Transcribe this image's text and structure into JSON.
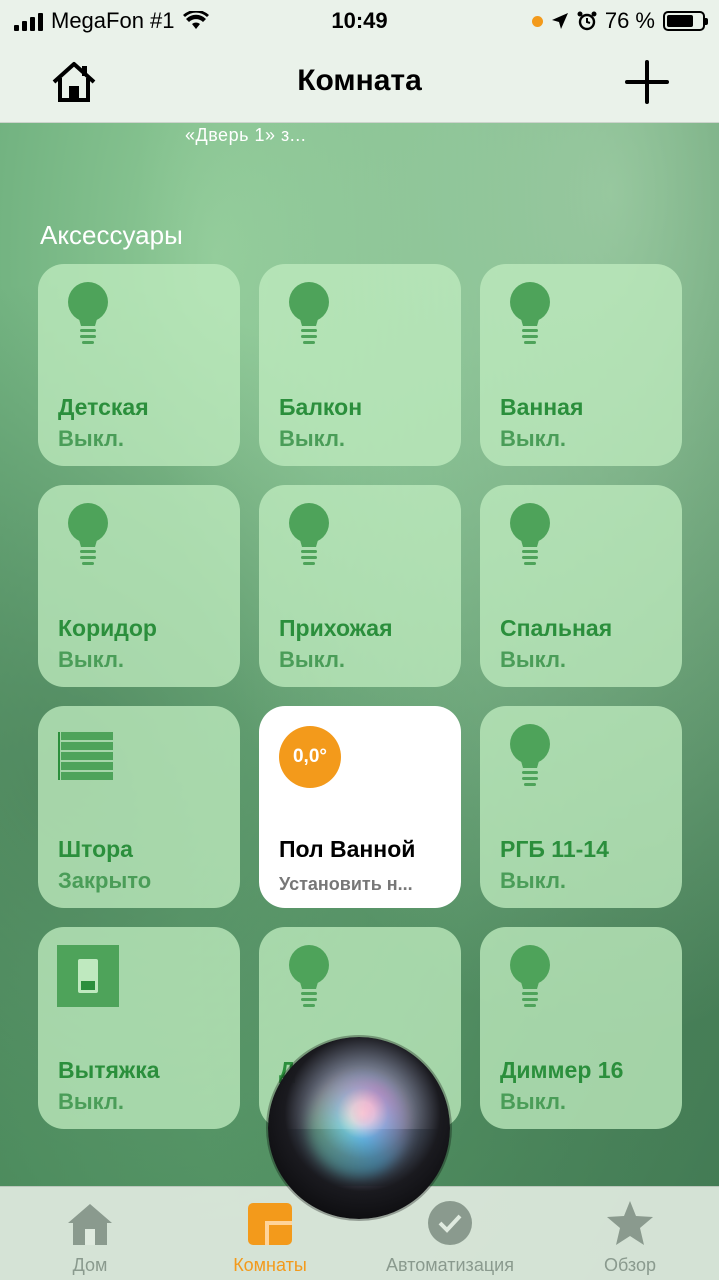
{
  "status_bar": {
    "carrier": "MegaFon #1",
    "time": "10:49",
    "battery_percent": "76 %",
    "battery_level": 0.76
  },
  "nav": {
    "title": "Комната",
    "home_icon": "house-icon",
    "add_icon": "plus-icon"
  },
  "room_status": "«Дверь 1» з...",
  "section_title": "Аксессуары",
  "accessories": [
    {
      "name": "Детская",
      "state": "Выкл.",
      "icon": "lightbulb-icon"
    },
    {
      "name": "Балкон",
      "state": "Выкл.",
      "icon": "lightbulb-icon"
    },
    {
      "name": "Ванная",
      "state": "Выкл.",
      "icon": "lightbulb-icon"
    },
    {
      "name": "Коридор",
      "state": "Выкл.",
      "icon": "lightbulb-icon"
    },
    {
      "name": "Прихожая",
      "state": "Выкл.",
      "icon": "lightbulb-icon"
    },
    {
      "name": "Спальная",
      "state": "Выкл.",
      "icon": "lightbulb-icon"
    },
    {
      "name": "Штора",
      "state": "Закрыто",
      "icon": "blinds-icon"
    },
    {
      "name": "Пол Ванной",
      "state": "Установить н...",
      "icon": "thermostat-badge",
      "badge": "0,0°",
      "active": true
    },
    {
      "name": "РГБ 11-14",
      "state": "Выкл.",
      "icon": "lightbulb-icon"
    },
    {
      "name": "Вытяжка",
      "state": "Выкл.",
      "icon": "switch-icon"
    },
    {
      "name": "Д",
      "state": "",
      "icon": "lightbulb-icon"
    },
    {
      "name": "Диммер 16",
      "state": "Выкл.",
      "icon": "lightbulb-icon"
    }
  ],
  "tabs": [
    {
      "label": "Дом",
      "icon": "house-icon"
    },
    {
      "label": "Комнаты",
      "icon": "rooms-icon",
      "selected": true
    },
    {
      "label": "Автоматизация",
      "icon": "clock-check-icon"
    },
    {
      "label": "Обзор",
      "icon": "star-icon"
    }
  ],
  "colors": {
    "accent": "#f39a1b",
    "tile_text": "#2b8f3c",
    "tile_bg": "#bee9be"
  }
}
